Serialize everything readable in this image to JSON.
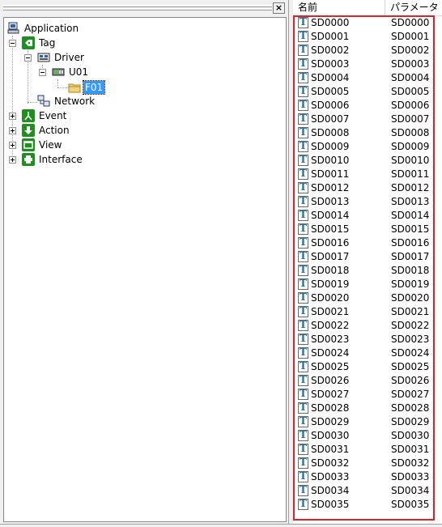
{
  "tree": {
    "nodes": [
      {
        "id": "application",
        "label": "Application",
        "icon": "computer-icon"
      },
      {
        "id": "tag",
        "label": "Tag",
        "icon": "tag-icon"
      },
      {
        "id": "driver",
        "label": "Driver",
        "icon": "driver-icon"
      },
      {
        "id": "u01",
        "label": "U01",
        "icon": "device-icon"
      },
      {
        "id": "f01",
        "label": "F01",
        "icon": "folder-icon",
        "selected": true
      },
      {
        "id": "network",
        "label": "Network",
        "icon": "network-icon"
      },
      {
        "id": "event",
        "label": "Event",
        "icon": "event-icon"
      },
      {
        "id": "action",
        "label": "Action",
        "icon": "action-icon"
      },
      {
        "id": "view",
        "label": "View",
        "icon": "view-icon"
      },
      {
        "id": "interface",
        "label": "Interface",
        "icon": "interface-icon"
      }
    ]
  },
  "pane": {
    "close_label": "×"
  },
  "list": {
    "headers": [
      "名前",
      "パラメータ"
    ],
    "rows": [
      [
        "SD0000",
        "SD0000"
      ],
      [
        "SD0001",
        "SD0001"
      ],
      [
        "SD0002",
        "SD0002"
      ],
      [
        "SD0003",
        "SD0003"
      ],
      [
        "SD0004",
        "SD0004"
      ],
      [
        "SD0005",
        "SD0005"
      ],
      [
        "SD0006",
        "SD0006"
      ],
      [
        "SD0007",
        "SD0007"
      ],
      [
        "SD0008",
        "SD0008"
      ],
      [
        "SD0009",
        "SD0009"
      ],
      [
        "SD0010",
        "SD0010"
      ],
      [
        "SD0011",
        "SD0011"
      ],
      [
        "SD0012",
        "SD0012"
      ],
      [
        "SD0013",
        "SD0013"
      ],
      [
        "SD0014",
        "SD0014"
      ],
      [
        "SD0015",
        "SD0015"
      ],
      [
        "SD0016",
        "SD0016"
      ],
      [
        "SD0017",
        "SD0017"
      ],
      [
        "SD0018",
        "SD0018"
      ],
      [
        "SD0019",
        "SD0019"
      ],
      [
        "SD0020",
        "SD0020"
      ],
      [
        "SD0021",
        "SD0021"
      ],
      [
        "SD0022",
        "SD0022"
      ],
      [
        "SD0023",
        "SD0023"
      ],
      [
        "SD0024",
        "SD0024"
      ],
      [
        "SD0025",
        "SD0025"
      ],
      [
        "SD0026",
        "SD0026"
      ],
      [
        "SD0027",
        "SD0027"
      ],
      [
        "SD0028",
        "SD0028"
      ],
      [
        "SD0029",
        "SD0029"
      ],
      [
        "SD0030",
        "SD0030"
      ],
      [
        "SD0031",
        "SD0031"
      ],
      [
        "SD0032",
        "SD0032"
      ],
      [
        "SD0033",
        "SD0033"
      ],
      [
        "SD0034",
        "SD0034"
      ],
      [
        "SD0035",
        "SD0035"
      ]
    ]
  },
  "colors": {
    "highlight": "#e0202a",
    "selection": "#3399ff",
    "icon_green": "#1f8f1f",
    "tag_t": "#1a6fb0"
  }
}
